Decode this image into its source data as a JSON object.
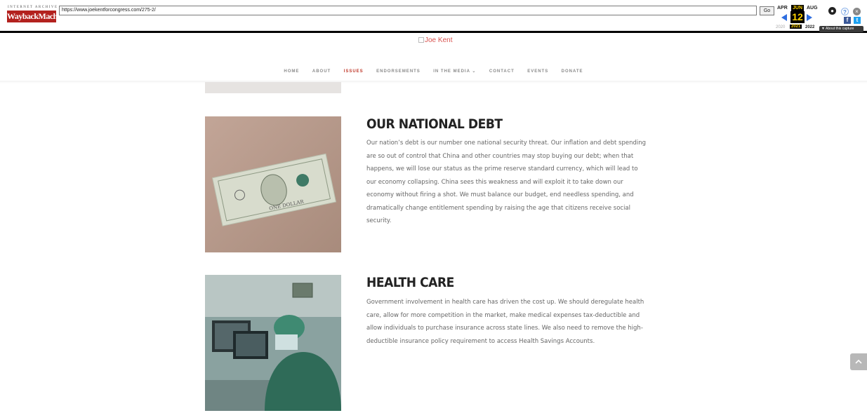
{
  "wayback": {
    "logo_top": "INTERNET ARCHIVE",
    "logo_main": "WaybackMachine",
    "url": "https://www.joekentforcongress.com/275-2/",
    "go_label": "Go",
    "months": {
      "prev": "APR",
      "current": "JUN",
      "next": "AUG"
    },
    "day": "12",
    "years": {
      "prev": "2020",
      "current": "2021",
      "next": "2022"
    },
    "about_label": "▼ About this capture",
    "colors": {
      "logo": "#b3211e",
      "highlight": "#ffd400",
      "arrow": "#2f6ee0"
    }
  },
  "site": {
    "logo_alt": "Joe Kent",
    "nav": {
      "home": "HOME",
      "about": "ABOUT",
      "issues": "ISSUES",
      "endorsements": "ENDORSEMENTS",
      "in_the_media": "IN THE MEDIA ⌄",
      "contact": "CONTACT",
      "events": "EVENTS",
      "donate": "DONATE"
    },
    "active_nav": "ISSUES",
    "accent": "#c0392b"
  },
  "issues": [
    {
      "title": "OUR NATIONAL DEBT",
      "lines": [
        "Our nation’s debt is our number one national security threat. Our inflation and debt spending",
        "are so out of control that China and other countries may stop buying our debt; when that",
        "happens, we will lose our status as the prime reserve standard currency, which will lead to",
        "our economy collapsing. China sees this weakness and will exploit it to take down our",
        "economy without firing a shot. We must balance our budget, end needless spending, and",
        "dramatically change entitlement spending by raising the age that citizens receive social",
        "security."
      ]
    },
    {
      "title": "HEALTH CARE",
      "lines": [
        "Government involvement in health care has driven the cost up. We should deregulate health",
        "care, allow for more competition in the market, make medical expenses tax-deductible and",
        "allow individuals to purchase insurance across state lines. We also need to remove the high-",
        "deductible insurance policy requirement to access Health Savings Accounts."
      ]
    }
  ]
}
